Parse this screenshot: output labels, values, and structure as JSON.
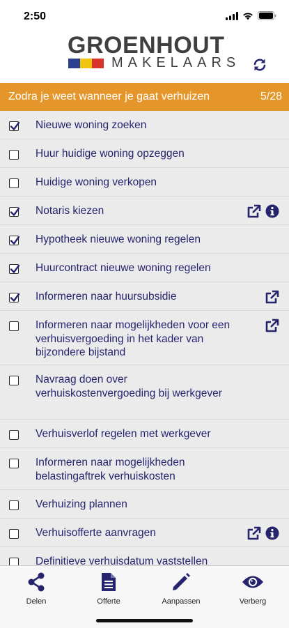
{
  "status_bar": {
    "time": "2:50"
  },
  "header": {
    "logo_title": "GROENHOUT",
    "logo_subtitle": "MAKELAARS"
  },
  "banner": {
    "title": "Zodra je weet wanneer je gaat verhuizen",
    "count": "5/28"
  },
  "colors": {
    "accent": "#e5962a",
    "text": "#26246e",
    "flag": [
      "#2b3f8f",
      "#f1c40f",
      "#d9342b"
    ]
  },
  "items": [
    {
      "label": "Nieuwe woning zoeken",
      "checked": true,
      "icons": []
    },
    {
      "label": "Huur huidige woning opzeggen",
      "checked": false,
      "icons": []
    },
    {
      "label": "Huidige woning verkopen",
      "checked": false,
      "icons": []
    },
    {
      "label": "Notaris kiezen",
      "checked": true,
      "icons": [
        "external-link-icon",
        "info-icon"
      ]
    },
    {
      "label": "Hypotheek nieuwe woning regelen",
      "checked": true,
      "icons": []
    },
    {
      "label": "Huurcontract nieuwe woning regelen",
      "checked": true,
      "icons": []
    },
    {
      "label": "Informeren naar huursubsidie",
      "checked": true,
      "icons": [
        "external-link-icon"
      ]
    },
    {
      "label": "Informeren naar mogelijkheden voor een verhuisvergoeding in het kader van bijzondere bijstand",
      "checked": false,
      "icons": [
        "external-link-icon"
      ]
    },
    {
      "label": "Navraag doen over verhuiskostenvergoeding bij werkgever",
      "checked": false,
      "icons": []
    },
    {
      "label": "Verhuisverlof regelen met werkgever",
      "checked": false,
      "icons": []
    },
    {
      "label": "Informeren naar mogelijkheden belastingaftrek verhuiskosten",
      "checked": false,
      "icons": []
    },
    {
      "label": "Verhuizing plannen",
      "checked": false,
      "icons": []
    },
    {
      "label": "Verhuisofferte aanvragen",
      "checked": false,
      "icons": [
        "external-link-icon",
        "info-icon"
      ]
    },
    {
      "label": "Definitieve verhuisdatum vaststellen",
      "checked": false,
      "icons": []
    }
  ],
  "tabs": [
    {
      "label": "Delen",
      "icon": "share-icon"
    },
    {
      "label": "Offerte",
      "icon": "document-icon"
    },
    {
      "label": "Aanpassen",
      "icon": "pencil-icon"
    },
    {
      "label": "Verberg",
      "icon": "eye-icon"
    }
  ]
}
